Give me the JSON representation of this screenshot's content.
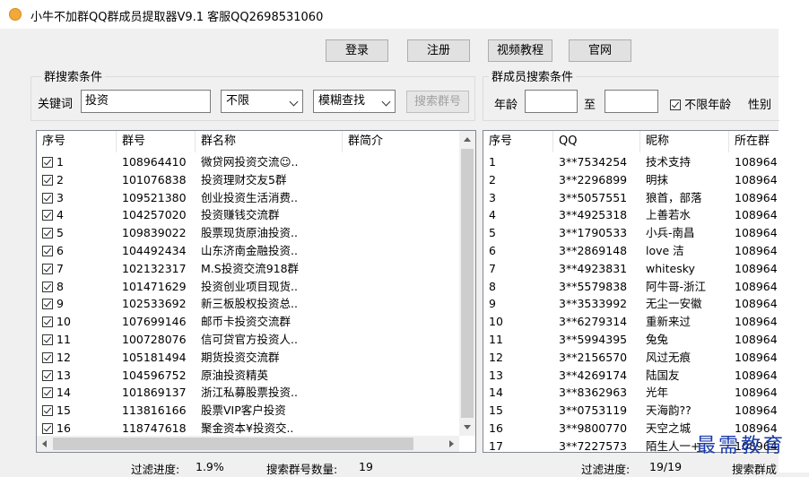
{
  "title": "小牛不加群QQ群成员提取器V9.1    客服QQ2698531060",
  "buttons": {
    "login": "登录",
    "register": "注册",
    "video": "视频教程",
    "site": "官网",
    "search_group": "搜索群号"
  },
  "group_search": {
    "label": "群搜索条件",
    "keyword_label": "关键词",
    "keyword_value": "投资",
    "limit_value": "不限",
    "mode_value": "模糊查找"
  },
  "member_search": {
    "label": "群成员搜索条件",
    "age_label": "年龄",
    "to_label": "至",
    "unlimited_age_label": "不限年龄",
    "gender_label": "性别"
  },
  "group_table": {
    "headers": [
      "序号",
      "群号",
      "群名称",
      "群简介"
    ],
    "rows": [
      [
        "1",
        "108964410",
        "微贷网投资交流☺.."
      ],
      [
        "2",
        "101076838",
        "投资理财交友5群"
      ],
      [
        "3",
        "109521380",
        "创业投资生活消费.."
      ],
      [
        "4",
        "104257020",
        "投资赚钱交流群"
      ],
      [
        "5",
        "109839022",
        "股票现货原油投资.."
      ],
      [
        "6",
        "104492434",
        " 山东济南金融投资.."
      ],
      [
        "7",
        "102132317",
        " M.S投资交流918群"
      ],
      [
        "8",
        "101471629",
        "投资创业项目现货.."
      ],
      [
        "9",
        "102533692",
        " 新三板股权投资总.."
      ],
      [
        "10",
        "107699146",
        " 邮币卡投资交流群"
      ],
      [
        "11",
        "100728076",
        " 信可贷官方投资人.."
      ],
      [
        "12",
        "105181494",
        "期货投资交流群"
      ],
      [
        "13",
        "104596752",
        "原油投资精英"
      ],
      [
        "14",
        "101869137",
        "浙江私募股票投资.."
      ],
      [
        "15",
        "113816166",
        "股票VIP客户投资"
      ],
      [
        "16",
        "118747618",
        "聚金资本¥投资交.."
      ]
    ]
  },
  "member_table": {
    "headers": [
      "序号",
      "QQ",
      "昵称",
      "所在群"
    ],
    "rows": [
      [
        "1",
        "3**7534254",
        "技术支持",
        "108964"
      ],
      [
        "2",
        "3**2296899",
        "明抹",
        "108964"
      ],
      [
        "3",
        "3**5057551",
        "狼首，部落",
        "108964"
      ],
      [
        "4",
        "3**4925318",
        "上善若水",
        "108964"
      ],
      [
        "5",
        "3**1790533",
        "小兵-南昌",
        "108964"
      ],
      [
        "6",
        "3**2869148",
        "love 洁",
        "108964"
      ],
      [
        "7",
        "3**4923831",
        "whitesky",
        "108964"
      ],
      [
        "8",
        "3**5579838",
        "阿牛哥-浙江",
        "108964"
      ],
      [
        "9",
        "3**3533992",
        "无尘一安徽",
        "108964"
      ],
      [
        "10",
        "3**6279314",
        "重新来过",
        "108964"
      ],
      [
        "11",
        "3**5994395",
        "兔兔",
        "108964"
      ],
      [
        "12",
        "3**2156570",
        "风过无痕",
        "108964"
      ],
      [
        "13",
        "3**4269174",
        "陆国友",
        "108964"
      ],
      [
        "14",
        "3**8362963",
        "光年",
        "108964"
      ],
      [
        "15",
        "3**0753119",
        "天海韵??",
        "108964"
      ],
      [
        "16",
        "3**9800770",
        "天空之城",
        "108964"
      ],
      [
        "17",
        "3**7227573",
        "陌生人一+",
        "108964"
      ]
    ]
  },
  "status": {
    "filter_label_left": "过滤进度:",
    "filter_value_left": "1.9%",
    "search_count_label": "搜索群号数量:",
    "search_count_value": "19",
    "filter_label_right": "过滤进度:",
    "filter_value_right": "19/19",
    "search_group_label_right": "搜索群成"
  },
  "watermark": "最需教育",
  "colors": {
    "window_bg": "#f0f0f0",
    "title_icon": "#f2a93b",
    "watermark": "#1a3aa8"
  }
}
